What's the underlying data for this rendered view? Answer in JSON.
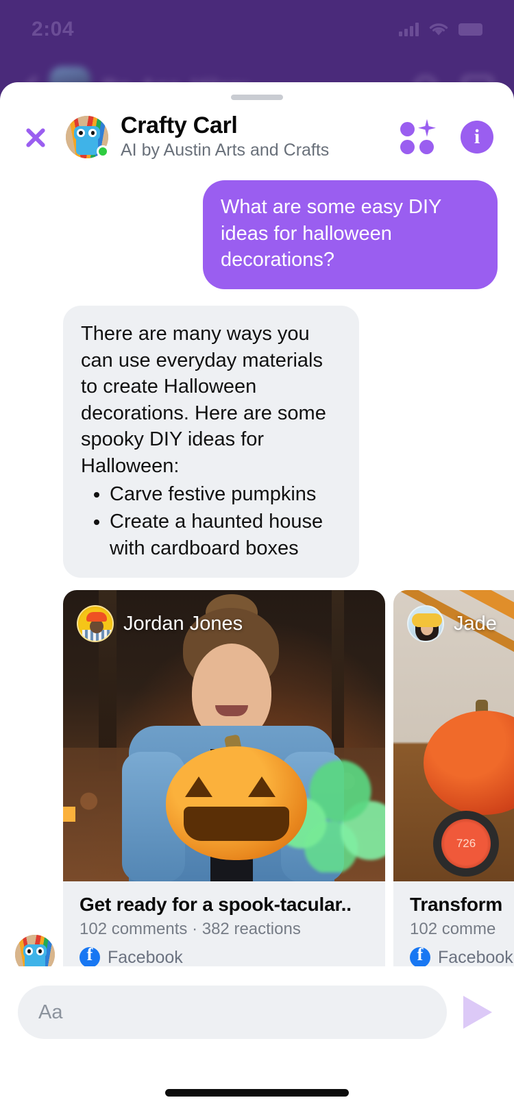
{
  "status_bar": {
    "time": "2:04",
    "signal_icon": "cellular-bars-icon",
    "wifi_icon": "wifi-icon",
    "battery_icon": "battery-icon"
  },
  "background": {
    "chat_title": "Bo, Ana, Hilary",
    "back_icon": "back-chevron-icon",
    "call_icon": "phone-icon",
    "video_icon": "video-icon"
  },
  "sheet": {
    "grabber": "drag-handle",
    "close_label": "close-icon",
    "bot": {
      "name": "Crafty Carl",
      "subtitle": "AI by Austin Arts and Crafts",
      "avatar_icon": "robot-avatar",
      "online_status": "online"
    },
    "actions": {
      "ai_icon": "ai-sparkle-icon",
      "info_icon": "info-icon"
    }
  },
  "conversation": {
    "user_message": "What are some easy DIY ideas for halloween decorations?",
    "ai_message_intro": "There are many ways you can use everyday materials to create Halloween decorations. Here are some spooky DIY ideas for Halloween:",
    "ai_message_bullets": [
      "Carve festive pumpkins",
      "Create a haunted house with cardboard boxes"
    ]
  },
  "cards": [
    {
      "author": "Jordan Jones",
      "author_avatar": "jordan-jones-avatar",
      "title": "Get ready for a spook-tacular..",
      "meta": "102 comments · 382 reactions",
      "source": "Facebook",
      "source_icon": "facebook-icon",
      "media_alt": "woman-holding-smoking-jack-o-lantern"
    },
    {
      "author": "Jade",
      "author_avatar": "jade-avatar",
      "title": "Transform",
      "meta": "102 comme",
      "source": "Facebook",
      "source_icon": "facebook-icon",
      "media_alt": "hand-with-orange-pumpkin-and-clock"
    }
  ],
  "composer": {
    "placeholder": "Aa",
    "value": "",
    "send_icon": "send-arrow-icon"
  },
  "colors": {
    "brand_purple": "#9a5ef0",
    "backdrop_purple": "#4a2a7a",
    "bubble_gray": "#eef0f3",
    "facebook_blue": "#1877f2",
    "online_green": "#2ecc40"
  }
}
